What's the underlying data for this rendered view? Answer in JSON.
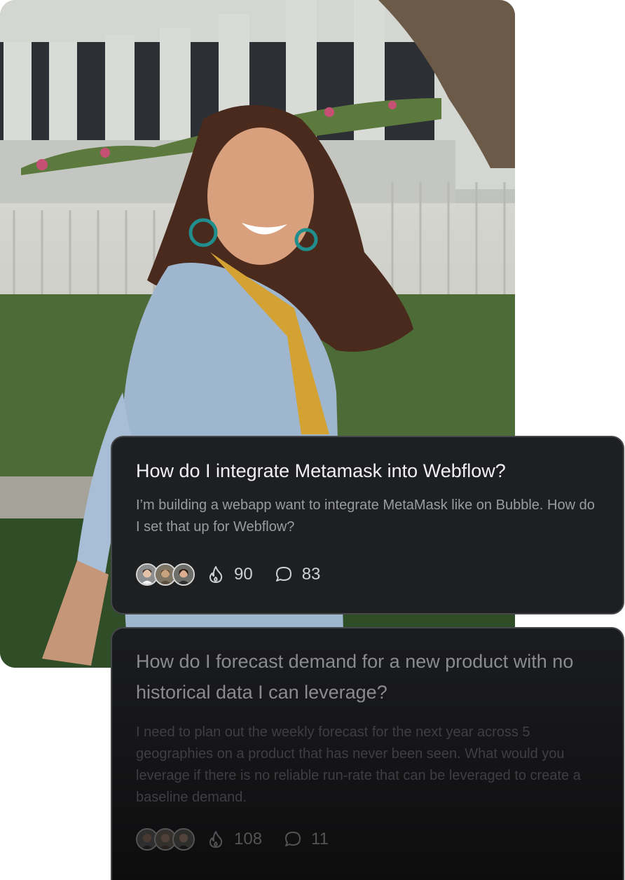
{
  "cards": [
    {
      "title": "How do I integrate Metamask into Webflow?",
      "body": "I’m building a webapp want to integrate MetaMask like on Bubble. How do I set that up for Webflow?",
      "likes": "90",
      "comments": "83"
    },
    {
      "title": "How do I forecast demand for a new product with no historical data I can leverage?",
      "body": "I need to plan out the weekly forecast for the next year across 5 geographies on a product that has never been seen. What would you leverage if there is no reliable run-rate that can be leveraged to create a baseline demand.",
      "likes": "108",
      "comments": "11"
    }
  ],
  "icons": {
    "likes": "flame-icon",
    "comments": "speech-bubble-icon"
  },
  "colors": {
    "card_background": "#1e1f21",
    "card_border": "#45474b",
    "title_text": "#f1f1f3",
    "body_text": "#9a9ba0"
  }
}
